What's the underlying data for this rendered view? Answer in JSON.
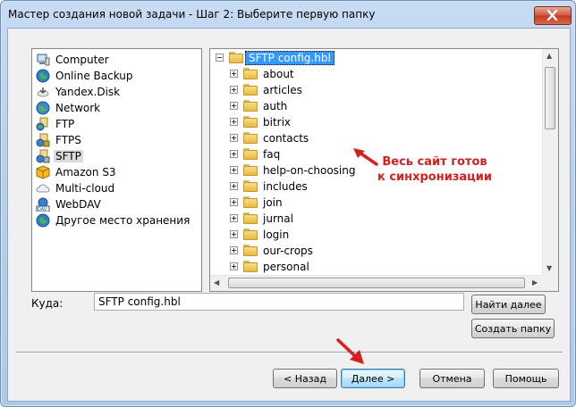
{
  "window": {
    "title": "Мастер создания новой задачи - Шаг 2: Выберите первую папку",
    "close_icon": "close-x-icon"
  },
  "storage_list": {
    "items": [
      {
        "label": "Computer",
        "icon": "computer-icon"
      },
      {
        "label": "Online Backup",
        "icon": "globe-icon"
      },
      {
        "label": "Yandex.Disk",
        "icon": "yandex-disk-icon"
      },
      {
        "label": "Network",
        "icon": "network-globe-icon"
      },
      {
        "label": "FTP",
        "icon": "ftp-icon"
      },
      {
        "label": "FTPS",
        "icon": "ftps-icon"
      },
      {
        "label": "SFTP",
        "icon": "sftp-icon",
        "selected": true
      },
      {
        "label": "Amazon S3",
        "icon": "amazon-s3-cube-icon"
      },
      {
        "label": "Multi-cloud",
        "icon": "cloud-icon"
      },
      {
        "label": "WebDAV",
        "icon": "webdav-icon"
      },
      {
        "label": "Другое место хранения",
        "icon": "other-storage-globe-icon"
      }
    ]
  },
  "folder_tree": {
    "root": "SFTP config.hbl",
    "folders": [
      "about",
      "articles",
      "auth",
      "bitrix",
      "contacts",
      "faq",
      "help-on-choosing",
      "includes",
      "join",
      "jurnal",
      "login",
      "our-crops",
      "personal"
    ]
  },
  "annotation": {
    "text": "Весь сайт готов к синхронизации",
    "color": "#d42020"
  },
  "destination": {
    "label": "Куда:",
    "value": "SFTP config.hbl"
  },
  "buttons": {
    "find_next": "Найти далее",
    "create_folder": "Создать папку",
    "back": "< Назад",
    "next": "Далее >",
    "cancel": "Отмена",
    "help": "Помощь"
  }
}
